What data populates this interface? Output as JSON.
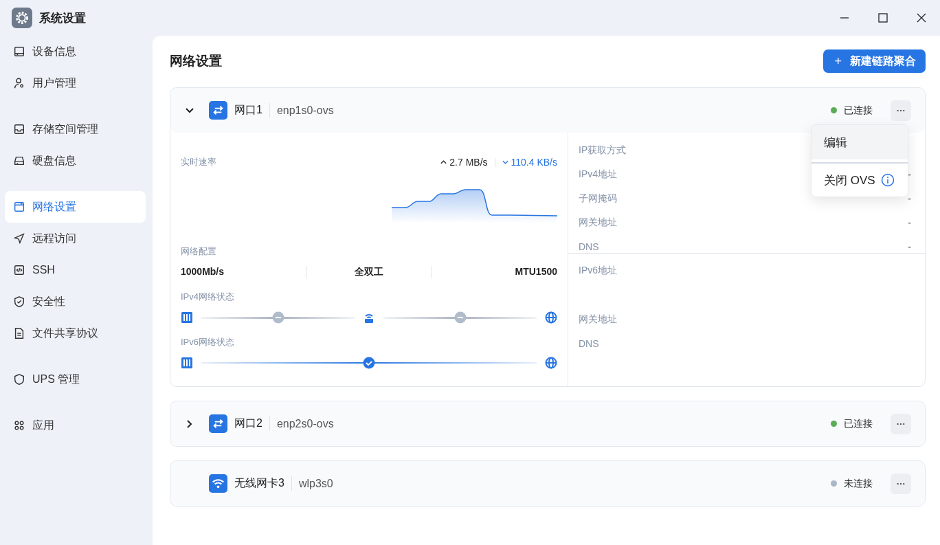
{
  "window": {
    "title": "系统设置"
  },
  "sidebar": {
    "groups": [
      {
        "items": [
          {
            "label": "设备信息",
            "selected": false
          },
          {
            "label": "用户管理",
            "selected": false
          }
        ]
      },
      {
        "items": [
          {
            "label": "存储空间管理",
            "selected": false
          },
          {
            "label": "硬盘信息",
            "selected": false
          }
        ]
      },
      {
        "items": [
          {
            "label": "网络设置",
            "selected": true
          },
          {
            "label": "远程访问",
            "selected": false
          },
          {
            "label": "SSH",
            "selected": false
          },
          {
            "label": "安全性",
            "selected": false
          },
          {
            "label": "文件共享协议",
            "selected": false
          }
        ]
      },
      {
        "items": [
          {
            "label": "UPS 管理",
            "selected": false
          }
        ]
      },
      {
        "items": [
          {
            "label": "应用",
            "selected": false
          }
        ]
      }
    ]
  },
  "page": {
    "title": "网络设置",
    "add_button": "新建链路聚合",
    "add_icon": "+"
  },
  "interfaces": [
    {
      "kind": "ethernet",
      "expanded": true,
      "name": "网口1",
      "device": "enp1s0-ovs",
      "status": "已连接",
      "color": "#5aac55",
      "details": {
        "speed": {
          "label": "实时速率",
          "up": "2.7 MB/s",
          "down": "110.4 KB/s"
        },
        "config": {
          "label": "网络配置",
          "values": [
            "1000Mb/s",
            "全双工",
            "MTU1500"
          ]
        },
        "ipv4_status": {
          "label": "IPv4网络状态",
          "path": [
            {
              "kind": "device"
            },
            {
              "kind": "link",
              "connected": false
            },
            {
              "kind": "router"
            },
            {
              "kind": "link",
              "connected": false
            },
            {
              "kind": "internet"
            }
          ]
        },
        "ipv6_status": {
          "label": "IPv6网络状态",
          "path": [
            {
              "kind": "device"
            },
            {
              "kind": "link",
              "connected": true
            },
            {
              "kind": "internet"
            }
          ]
        },
        "ipv4": [
          {
            "label": "IP获取方式"
          },
          {
            "label": "IPv4地址",
            "value": "-"
          },
          {
            "label": "子网掩码",
            "value": "-"
          },
          {
            "label": "网关地址",
            "value": "-"
          },
          {
            "label": "DNS",
            "value": "-"
          }
        ],
        "ipv6": [
          {
            "label": "IPv6地址"
          },
          {
            "label": "网关地址"
          },
          {
            "label": "DNS"
          }
        ]
      },
      "menu": [
        {
          "label": "编辑",
          "highlighted": true
        },
        {
          "label": "关闭 OVS",
          "highlighted": false,
          "info": true
        }
      ]
    },
    {
      "kind": "ethernet",
      "expanded": false,
      "name": "网口2",
      "device": "enp2s0-ovs",
      "status": "已连接",
      "color": "#5aac55"
    },
    {
      "kind": "wifi",
      "name": "无线网卡3",
      "device": "wlp3s0",
      "status": "未连接",
      "color": "#a9b7c9"
    }
  ]
}
